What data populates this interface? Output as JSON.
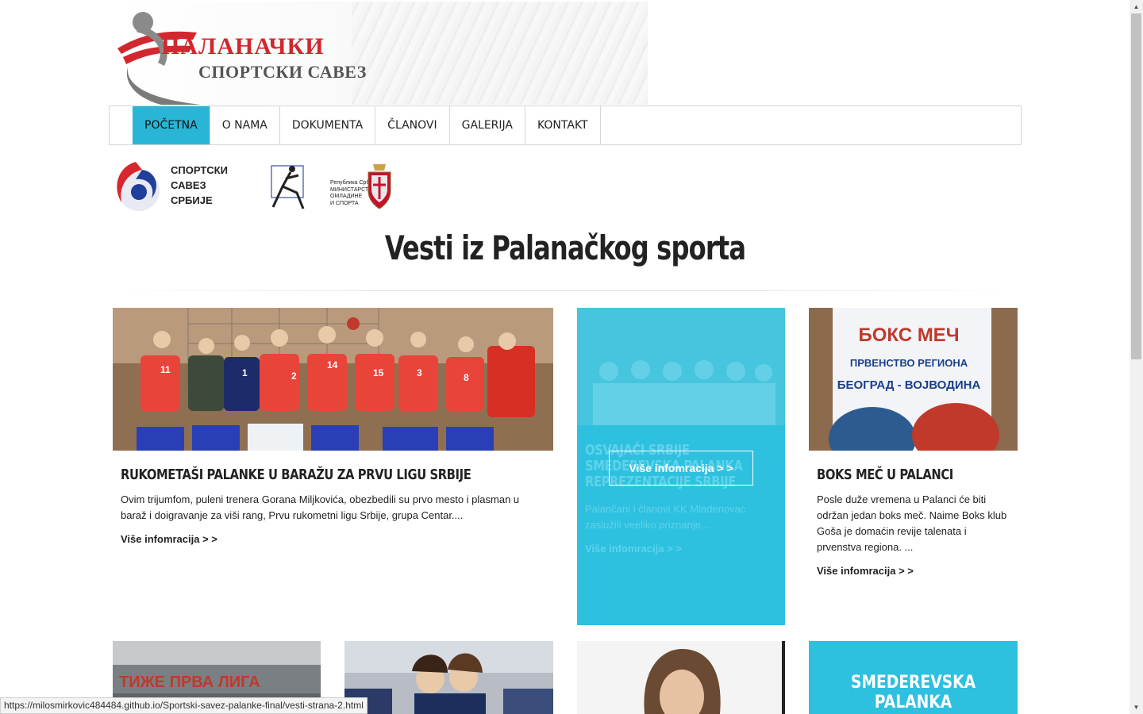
{
  "header": {
    "title": "ПАЛАНАЧКИ",
    "subtitle": "СПОРТСКИ САВЕЗ"
  },
  "nav": {
    "items": [
      "POČETNA",
      "O NAMA",
      "DOKUMENTA",
      "ČLANOVI",
      "GALERIJA",
      "KONTAKT"
    ],
    "active": "POČETNA"
  },
  "partners": {
    "ssz_lines": [
      "СПОРТСКИ",
      "САВЕЗ",
      "СРБИЈЕ"
    ],
    "ministry_lines": [
      "Република Србија",
      "МИНИСТАРСТВО",
      "ОМЛАДИНЕ",
      "И СПОРТА"
    ]
  },
  "section": {
    "title": "Vesti iz Palanačkog sporta"
  },
  "cards": [
    {
      "title": "RUKOMETAŠI PALANKE U BARAŽU ZA PRVU LIGU SRBIJE",
      "text": "Ovim trijumfom, puleni trenera Gorana Miljkovića, obezbedili su prvo mesto i plasman u baraž i doigravanje za viši rang, Prvu rukometni ligu Srbije, grupa Centar....",
      "more": "Više infomracija > >"
    },
    {
      "title_lines": [
        "OSVAJAČI SRBIJE",
        "SMEDEREVSKA PALANKA",
        "REPREZENTACIJE SRBIJE"
      ],
      "text": "Palančani i članovi KK Mladenovac zaslužili veeliko priznanje...",
      "more": "Više infomracija > >",
      "overlay_button": "Više infomracija > >"
    },
    {
      "title": "BOKS MEČ U PALANCI",
      "text": "Posle duže vremena u Palanci će biti održan jedan boks meč. Naime Boks klub Goša je domaćin revije talenata i prvenstva regiona. ...",
      "more": "Više infomracija > >",
      "poster_lines": [
        "БОКС МЕЧ",
        "ПРВЕНСТВО РЕГИОНА",
        "БЕОГРАД - ВОЈВОДИНА"
      ]
    }
  ],
  "row2": {
    "banner_text": "ТИЖЕ ПРВА ЛИГА",
    "brand": "SMEDEREVSKA PALANKA"
  },
  "status_bar": {
    "url": "https://milosmirkovic484484.github.io/Sportski-savez-palanke-final/vesti-strana-2.html"
  },
  "colors": {
    "accent": "#2ec0df",
    "logo_red": "#d0282e"
  }
}
